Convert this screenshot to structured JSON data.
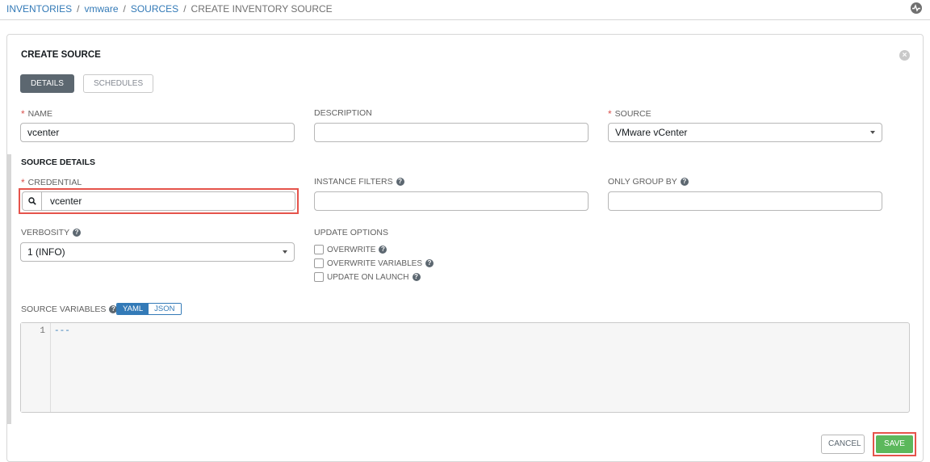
{
  "breadcrumb": {
    "items": [
      "INVENTORIES",
      "vmware",
      "SOURCES"
    ],
    "separator": "/",
    "current": "CREATE INVENTORY SOURCE"
  },
  "panel": {
    "title": "CREATE SOURCE",
    "tabs": {
      "details": "DETAILS",
      "schedules": "SCHEDULES"
    }
  },
  "form": {
    "name": {
      "label": "NAME",
      "value": "vcenter"
    },
    "description": {
      "label": "DESCRIPTION",
      "value": ""
    },
    "source": {
      "label": "SOURCE",
      "value": "VMware vCenter"
    },
    "section_title": "SOURCE DETAILS",
    "credential": {
      "label": "CREDENTIAL",
      "value": "vcenter"
    },
    "instance_filters": {
      "label": "INSTANCE FILTERS",
      "value": ""
    },
    "only_group_by": {
      "label": "ONLY GROUP BY",
      "value": ""
    },
    "verbosity": {
      "label": "VERBOSITY",
      "value": "1 (INFO)"
    },
    "update_options": {
      "label": "UPDATE OPTIONS",
      "overwrite": "OVERWRITE",
      "overwrite_variables": "OVERWRITE VARIABLES",
      "update_on_launch": "UPDATE ON LAUNCH"
    },
    "source_variables": {
      "label": "SOURCE VARIABLES",
      "yaml": "YAML",
      "json": "JSON",
      "line_number": "1",
      "code": "---"
    }
  },
  "actions": {
    "cancel": "CANCEL",
    "save": "SAVE"
  },
  "colors": {
    "link": "#337ab7",
    "active_tab": "#5c6770",
    "save": "#5cb85c",
    "highlight": "#e5534b",
    "required": "#d9534f"
  }
}
